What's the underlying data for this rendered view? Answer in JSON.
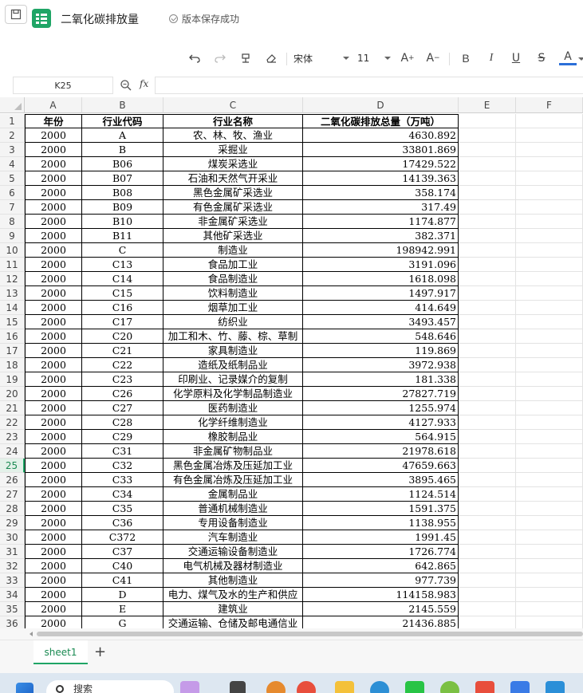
{
  "app": {
    "doc_title": "二氧化碳排放量",
    "save_status": "版本保存成功"
  },
  "toolbar": {
    "font_name": "宋体",
    "font_size": "11"
  },
  "formula_bar": {
    "cell_ref": "K25",
    "fx_label": "fx",
    "value": ""
  },
  "grid": {
    "columns": [
      "A",
      "B",
      "C",
      "D",
      "E",
      "F"
    ],
    "active_row": 25,
    "header": {
      "row_num": "1",
      "year": "年份",
      "code": "行业代码",
      "name": "行业名称",
      "emission": "二氧化碳排放总量（万吨）"
    },
    "rows": [
      {
        "n": "2",
        "year": "2000",
        "code": "A",
        "name": "农、林、牧、渔业",
        "value": "4630.892"
      },
      {
        "n": "3",
        "year": "2000",
        "code": "B",
        "name": "采掘业",
        "value": "33801.869"
      },
      {
        "n": "4",
        "year": "2000",
        "code": "B06",
        "name": "煤炭采选业",
        "value": "17429.522"
      },
      {
        "n": "5",
        "year": "2000",
        "code": "B07",
        "name": "石油和天然气开采业",
        "value": "14139.363"
      },
      {
        "n": "6",
        "year": "2000",
        "code": "B08",
        "name": "黑色金属矿采选业",
        "value": "358.174"
      },
      {
        "n": "7",
        "year": "2000",
        "code": "B09",
        "name": "有色金属矿采选业",
        "value": "317.49"
      },
      {
        "n": "8",
        "year": "2000",
        "code": "B10",
        "name": "非金属矿采选业",
        "value": "1174.877"
      },
      {
        "n": "9",
        "year": "2000",
        "code": "B11",
        "name": "其他矿采选业",
        "value": "382.371"
      },
      {
        "n": "10",
        "year": "2000",
        "code": "C",
        "name": "制造业",
        "value": "198942.991"
      },
      {
        "n": "11",
        "year": "2000",
        "code": "C13",
        "name": "食品加工业",
        "value": "3191.096"
      },
      {
        "n": "12",
        "year": "2000",
        "code": "C14",
        "name": "食品制造业",
        "value": "1618.098"
      },
      {
        "n": "13",
        "year": "2000",
        "code": "C15",
        "name": "饮料制造业",
        "value": "1497.917"
      },
      {
        "n": "14",
        "year": "2000",
        "code": "C16",
        "name": "烟草加工业",
        "value": "414.649"
      },
      {
        "n": "15",
        "year": "2000",
        "code": "C17",
        "name": "纺织业",
        "value": "3493.457"
      },
      {
        "n": "16",
        "year": "2000",
        "code": "C20",
        "name": "加工和木、竹、藤、棕、草制",
        "value": "548.646"
      },
      {
        "n": "17",
        "year": "2000",
        "code": "C21",
        "name": "家具制造业",
        "value": "119.869"
      },
      {
        "n": "18",
        "year": "2000",
        "code": "C22",
        "name": "造纸及纸制品业",
        "value": "3972.938"
      },
      {
        "n": "19",
        "year": "2000",
        "code": "C23",
        "name": "印刷业、记录媒介的复制",
        "value": "181.338"
      },
      {
        "n": "20",
        "year": "2000",
        "code": "C26",
        "name": "化学原料及化学制品制造业",
        "value": "27827.719"
      },
      {
        "n": "21",
        "year": "2000",
        "code": "C27",
        "name": "医药制造业",
        "value": "1255.974"
      },
      {
        "n": "22",
        "year": "2000",
        "code": "C28",
        "name": "化学纤维制造业",
        "value": "4127.933"
      },
      {
        "n": "23",
        "year": "2000",
        "code": "C29",
        "name": "橡胶制品业",
        "value": "564.915"
      },
      {
        "n": "24",
        "year": "2000",
        "code": "C31",
        "name": "非金属矿物制品业",
        "value": "21978.618"
      },
      {
        "n": "25",
        "year": "2000",
        "code": "C32",
        "name": "黑色金属冶炼及压延加工业",
        "value": "47659.663"
      },
      {
        "n": "26",
        "year": "2000",
        "code": "C33",
        "name": "有色金属冶炼及压延加工业",
        "value": "3895.465"
      },
      {
        "n": "27",
        "year": "2000",
        "code": "C34",
        "name": "金属制品业",
        "value": "1124.514"
      },
      {
        "n": "28",
        "year": "2000",
        "code": "C35",
        "name": "普通机械制造业",
        "value": "1591.375"
      },
      {
        "n": "29",
        "year": "2000",
        "code": "C36",
        "name": "专用设备制造业",
        "value": "1138.955"
      },
      {
        "n": "30",
        "year": "2000",
        "code": "C372",
        "name": "汽车制造业",
        "value": "1991.45"
      },
      {
        "n": "31",
        "year": "2000",
        "code": "C37",
        "name": "交通运输设备制造业",
        "value": "1726.774"
      },
      {
        "n": "32",
        "year": "2000",
        "code": "C40",
        "name": "电气机械及器材制造业",
        "value": "642.865"
      },
      {
        "n": "33",
        "year": "2000",
        "code": "C41",
        "name": "其他制造业",
        "value": "977.739"
      },
      {
        "n": "34",
        "year": "2000",
        "code": "D",
        "name": "电力、煤气及水的生产和供应",
        "value": "114158.983"
      },
      {
        "n": "35",
        "year": "2000",
        "code": "E",
        "name": "建筑业",
        "value": "2145.559"
      },
      {
        "n": "36",
        "year": "2000",
        "code": "G",
        "name": "交通运输、仓储及邮电通信业",
        "value": "21436.885"
      }
    ]
  },
  "sheets": {
    "tabs": [
      "sheet1"
    ],
    "add_label": "+"
  },
  "taskbar": {
    "search_placeholder": "搜索"
  }
}
